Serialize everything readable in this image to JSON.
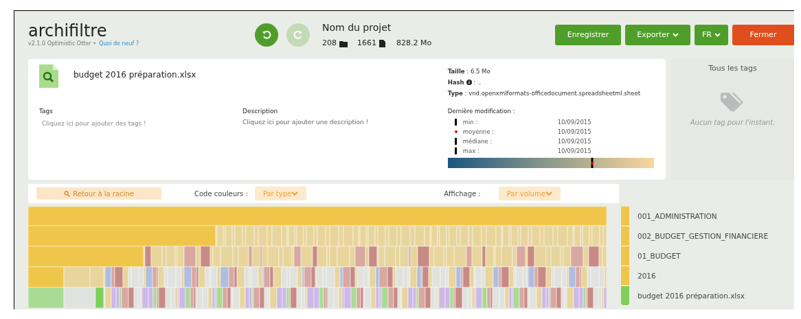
{
  "header": {
    "logo": "archifiltre",
    "version": "v2.1.0 Optimistic Otter •",
    "whats_new_link": "Quoi de neuf ?",
    "undo": {
      "disabled": false
    },
    "redo": {
      "disabled": true
    },
    "project_name": "Nom du projet",
    "folders": "208",
    "files": "1661",
    "size": "828.2 Mo",
    "buttons": [
      {
        "label": "Enregistrer",
        "kind": "primary",
        "dropdown": false
      },
      {
        "label": "Exporter",
        "kind": "primary",
        "dropdown": true
      },
      {
        "label": "FR",
        "kind": "primary",
        "dropdown": true
      },
      {
        "label": "Fermer",
        "kind": "danger",
        "dropdown": false
      }
    ]
  },
  "details": {
    "file_name": "budget 2016 préparation.xlsx",
    "tags": {
      "label": "Tags",
      "placeholder": "Cliquez ici pour ajouter des tags !"
    },
    "description": {
      "label": "Description",
      "placeholder": "Cliquez ici pour ajouter une description !"
    },
    "meta": [
      {
        "label": "Taille",
        "value": " : 6.5 Mo",
        "info": false
      },
      {
        "label": "Hash",
        "value": " : ..",
        "info": true
      },
      {
        "label": "Type",
        "value": " : vnd.openxmlformats-officedocument.spreadsheetml.sheet",
        "info": false
      }
    ],
    "last_modified": {
      "title": "Dernière modification :",
      "dates": [
        {
          "label": "min :",
          "value": "10/09/2015",
          "kind": "bar"
        },
        {
          "label": "moyenne :",
          "value": "10/09/2015",
          "kind": "dot"
        },
        {
          "label": "médiane :",
          "value": "10/09/2015",
          "kind": "bar"
        },
        {
          "label": "max :",
          "value": "10/09/2015",
          "kind": "bar"
        }
      ]
    }
  },
  "tags_panel": {
    "title": "Tous les tags",
    "empty_text": "Aucun tag pour l'instant."
  },
  "toolbar": {
    "back_button": {
      "label": "Retour à la racine",
      "disabled": true
    },
    "color_code": {
      "label": "Code couleurs :",
      "value": "Par type"
    },
    "display": {
      "label": "Affichage :",
      "value": "Par volume"
    }
  },
  "breadcrumbs": [
    {
      "label": "001_ADMINISTRATION",
      "color": "#f0c64a"
    },
    {
      "label": "002_BUDGET_GESTION_FINANCIERE",
      "color": "#f0c64a"
    },
    {
      "label": "01_BUDGET",
      "color": "#f0c64a"
    },
    {
      "label": "2016",
      "color": "#f0c64a"
    },
    {
      "label": "budget 2016 préparation.xlsx",
      "color": "#7ed05a"
    }
  ]
}
